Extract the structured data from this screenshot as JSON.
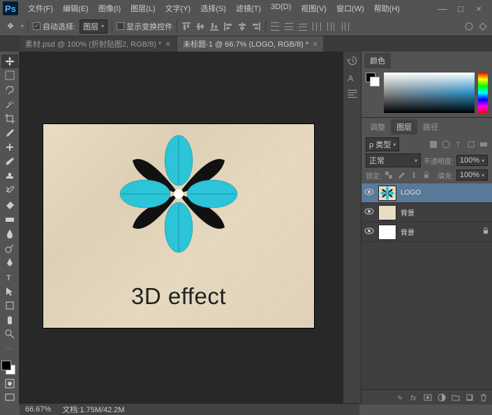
{
  "app": {
    "logo": "Ps"
  },
  "menu": [
    "文件(F)",
    "编辑(E)",
    "图像(I)",
    "图层(L)",
    "文字(Y)",
    "选择(S)",
    "滤镜(T)",
    "3D(D)",
    "视图(V)",
    "窗口(W)",
    "帮助(H)"
  ],
  "options": {
    "auto_select_label": "自动选择:",
    "auto_select_value": "图层",
    "transform_controls": "显示变换控件"
  },
  "tabs": [
    {
      "label": "素材.psd @ 100% (折射贴图2, RGB/8) *",
      "active": false
    },
    {
      "label": "未标题-1 @ 66.7% (LOGO, RGB/8) *",
      "active": true
    }
  ],
  "canvas_text": "3D effect",
  "panels": {
    "color_tab": "颜色",
    "layers_tabs": [
      "调整",
      "图层",
      "路径"
    ],
    "blend_mode": "正常",
    "opacity_label": "不透明度:",
    "opacity_value": "100%",
    "lock_label": "锁定:",
    "fill_label": "填充:",
    "fill_value": "100%",
    "kind_label": "ρ 类型"
  },
  "layers": [
    {
      "name": "LOGO",
      "selected": true,
      "thumb": "flower",
      "locked": false
    },
    {
      "name": "背景",
      "selected": false,
      "thumb": "solid",
      "locked": false
    },
    {
      "name": "背景",
      "selected": false,
      "thumb": "white",
      "locked": true
    }
  ],
  "status": {
    "zoom": "66.67%",
    "doc_info": "文档:1.75M/42.2M"
  }
}
